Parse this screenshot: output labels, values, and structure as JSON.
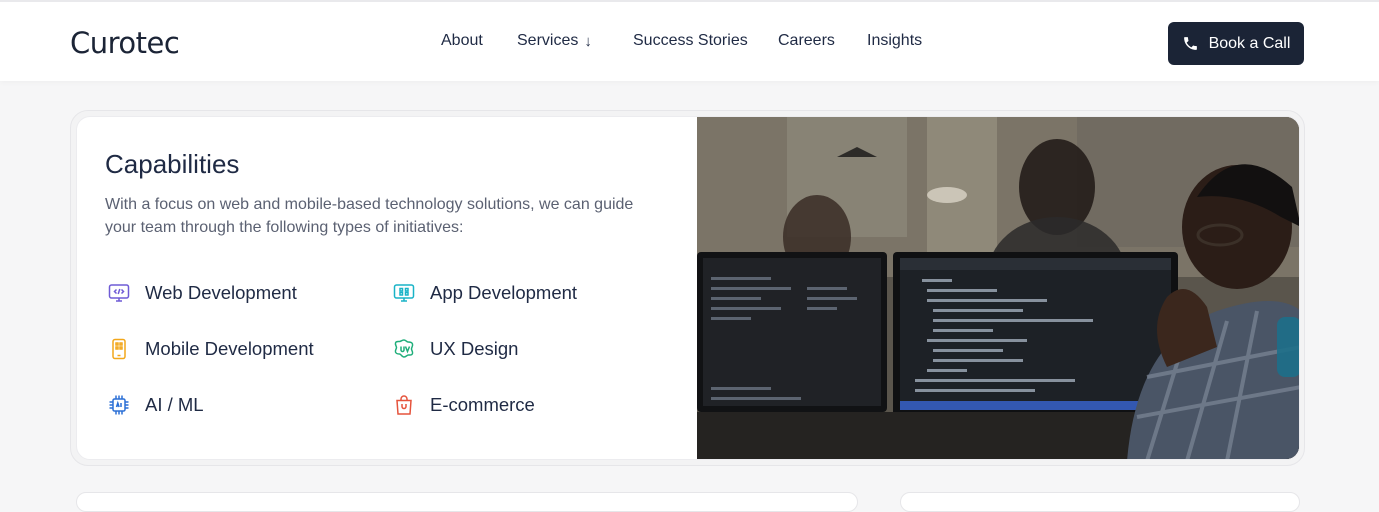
{
  "header": {
    "logo": "Curotec",
    "nav": [
      {
        "label": "About"
      },
      {
        "label": "Services",
        "arrow": "↓"
      },
      {
        "label": "Success Stories"
      },
      {
        "label": "Careers"
      },
      {
        "label": "Insights"
      }
    ],
    "cta": "Book a Call"
  },
  "capabilities": {
    "title": "Capabilities",
    "description": "With a focus on web and mobile-based technology solutions, we can guide your team through the following types of initiatives:",
    "items": [
      {
        "label": "Web Development",
        "icon": "monitor-code-icon",
        "color": "#6f5bd6"
      },
      {
        "label": "App Development",
        "icon": "monitor-grid-icon",
        "color": "#19b3c7"
      },
      {
        "label": "Mobile Development",
        "icon": "mobile-icon",
        "color": "#f2a71b"
      },
      {
        "label": "UX Design",
        "icon": "ux-palette-icon",
        "color": "#1fae7a"
      },
      {
        "label": "AI / ML",
        "icon": "ai-chip-icon",
        "color": "#2a6fd6"
      },
      {
        "label": "E-commerce",
        "icon": "shopping-bag-icon",
        "color": "#e5533c"
      }
    ]
  },
  "colors": {
    "primary": "#1b2436",
    "text": "#1f2a44",
    "muted": "#5b6172"
  }
}
